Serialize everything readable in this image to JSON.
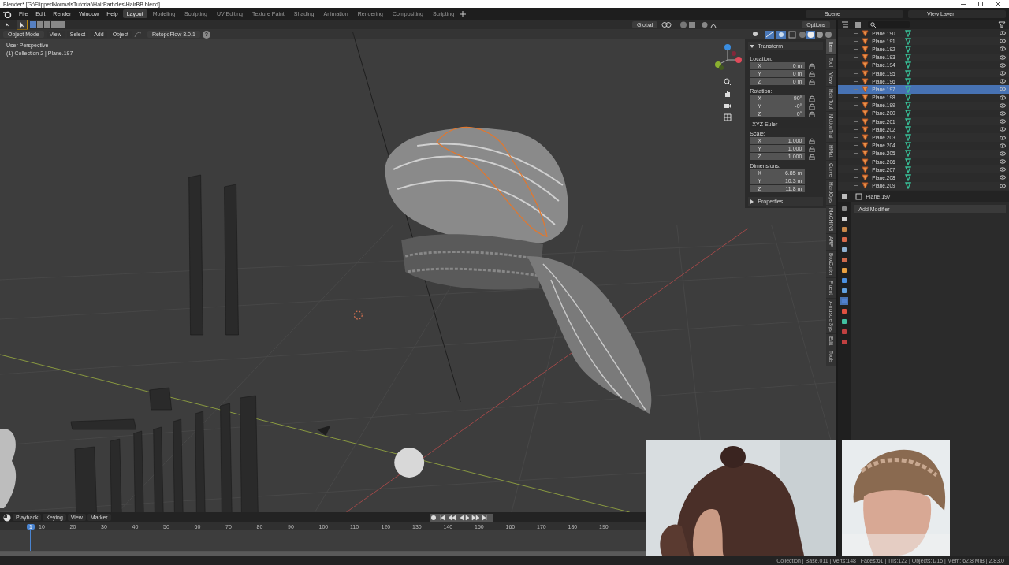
{
  "window": {
    "title": "Blender* [G:\\FlippedNormalsTutorial\\HairParticles\\HairBB.blend]"
  },
  "menu": [
    "File",
    "Edit",
    "Render",
    "Window",
    "Help"
  ],
  "workspaces": [
    {
      "label": "Layout",
      "selected": true
    },
    {
      "label": "Modeling",
      "selected": false
    },
    {
      "label": "Sculpting",
      "selected": false
    },
    {
      "label": "UV Editing",
      "selected": false
    },
    {
      "label": "Texture Paint",
      "selected": false
    },
    {
      "label": "Shading",
      "selected": false
    },
    {
      "label": "Animation",
      "selected": false
    },
    {
      "label": "Rendering",
      "selected": false
    },
    {
      "label": "Compositing",
      "selected": false
    },
    {
      "label": "Scripting",
      "selected": false
    }
  ],
  "scene": {
    "name": "Scene",
    "view_layer": "View Layer"
  },
  "viewport": {
    "mode": "Object Mode",
    "menus": [
      "View",
      "Select",
      "Add",
      "Object"
    ],
    "addon": "RetopoFlow 3.0.1",
    "help": "?",
    "orientation": "Global",
    "options": "Options",
    "overlay": [
      "User Perspective",
      "(1) Collection 2 | Plane.197"
    ]
  },
  "n_panel": {
    "tabs": [
      {
        "label": "Item",
        "selected": true
      },
      {
        "label": "Tool",
        "selected": false
      },
      {
        "label": "View",
        "selected": false
      },
      {
        "label": "Hair Tool",
        "selected": false
      },
      {
        "label": "MotionTrail",
        "selected": false
      },
      {
        "label": "HMat",
        "selected": false
      },
      {
        "label": "Curve",
        "selected": false
      },
      {
        "label": "HardOps",
        "selected": false
      },
      {
        "label": "MACHIN3",
        "selected": false
      },
      {
        "label": "ARP",
        "selected": false
      },
      {
        "label": "BoxCutter",
        "selected": false
      },
      {
        "label": "Fluent",
        "selected": false
      },
      {
        "label": "x-muscle Sys",
        "selected": false
      },
      {
        "label": "Edit",
        "selected": false
      },
      {
        "label": "Tools",
        "selected": false
      }
    ],
    "sections": [
      {
        "title": "Transform",
        "expanded": true
      },
      {
        "title": "Properties",
        "expanded": false
      }
    ],
    "groups": [
      {
        "label": "Location:",
        "locks": true,
        "fields": [
          {
            "axis": "X",
            "value": "0 m"
          },
          {
            "axis": "Y",
            "value": "0 m"
          },
          {
            "axis": "Z",
            "value": "0 m"
          }
        ]
      },
      {
        "label": "Rotation:",
        "locks": true,
        "fields": [
          {
            "axis": "X",
            "value": "90°"
          },
          {
            "axis": "Y",
            "value": "-0°"
          },
          {
            "axis": "Z",
            "value": "0°"
          }
        ],
        "mode": "XYZ Euler"
      },
      {
        "label": "Scale:",
        "locks": true,
        "fields": [
          {
            "axis": "X",
            "value": "1.000"
          },
          {
            "axis": "Y",
            "value": "1.000"
          },
          {
            "axis": "Z",
            "value": "1.000"
          }
        ]
      },
      {
        "label": "Dimensions:",
        "locks": false,
        "fields": [
          {
            "axis": "X",
            "value": "6.85 m"
          },
          {
            "axis": "Y",
            "value": "10.3 m"
          },
          {
            "axis": "Z",
            "value": "11.8 m"
          }
        ]
      }
    ]
  },
  "outliner": {
    "items": [
      {
        "name": "Plane.190",
        "selected": false
      },
      {
        "name": "Plane.191",
        "selected": false
      },
      {
        "name": "Plane.192",
        "selected": false
      },
      {
        "name": "Plane.193",
        "selected": false
      },
      {
        "name": "Plane.194",
        "selected": false
      },
      {
        "name": "Plane.195",
        "selected": false
      },
      {
        "name": "Plane.196",
        "selected": false
      },
      {
        "name": "Plane.197",
        "selected": true
      },
      {
        "name": "Plane.198",
        "selected": false
      },
      {
        "name": "Plane.199",
        "selected": false
      },
      {
        "name": "Plane.200",
        "selected": false
      },
      {
        "name": "Plane.201",
        "selected": false
      },
      {
        "name": "Plane.202",
        "selected": false
      },
      {
        "name": "Plane.203",
        "selected": false
      },
      {
        "name": "Plane.204",
        "selected": false
      },
      {
        "name": "Plane.205",
        "selected": false
      },
      {
        "name": "Plane.206",
        "selected": false
      },
      {
        "name": "Plane.207",
        "selected": false
      },
      {
        "name": "Plane.208",
        "selected": false
      },
      {
        "name": "Plane.209",
        "selected": false
      }
    ]
  },
  "properties": {
    "object": "Plane.197",
    "add_modifier": "Add Modifier"
  },
  "timeline": {
    "menus": [
      "Playback",
      "Keying",
      "View",
      "Marker"
    ],
    "current_frame": "1",
    "ticks": [
      "10",
      "20",
      "30",
      "40",
      "50",
      "60",
      "70",
      "80",
      "90",
      "100",
      "110",
      "120",
      "130",
      "140",
      "150",
      "160",
      "170",
      "180",
      "190"
    ]
  },
  "status_bar": "Collection | Base.011 | Verts:148 | Faces:61 | Tris:122 | Objects:1/15 | Mem: 62.8 MiB | 2.83.0"
}
